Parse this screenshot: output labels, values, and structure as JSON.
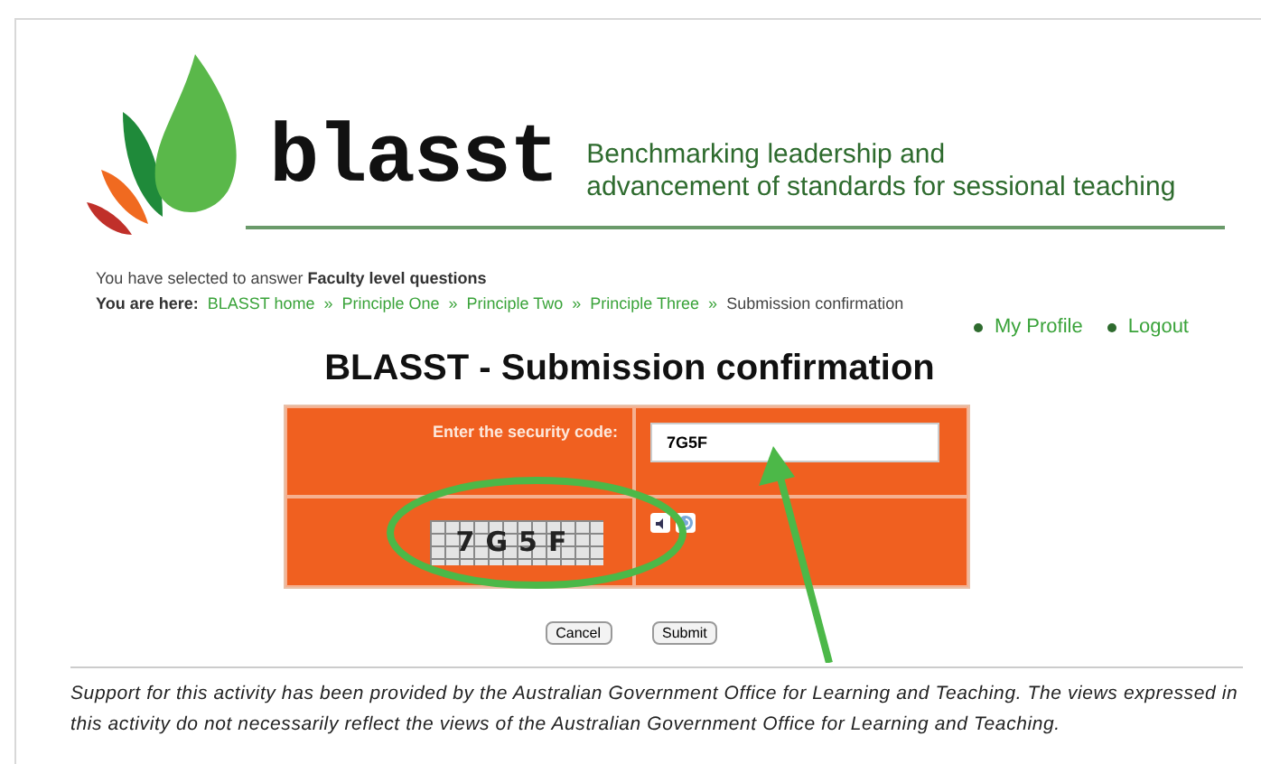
{
  "header": {
    "logo_text": "blasst",
    "tagline_lines": [
      "Benchmarking leadership and",
      "advancement of standards for sessional teaching"
    ]
  },
  "selection_note": {
    "prefix": "You have selected to answer ",
    "emphasis": "Faculty level questions"
  },
  "breadcrumb": {
    "label": "You are here:",
    "links": [
      "BLASST home",
      "Principle One",
      "Principle Two",
      "Principle Three"
    ],
    "separator": "»",
    "current": "Submission confirmation"
  },
  "user_links": [
    "My Profile",
    "Logout"
  ],
  "title": "BLASST - Submission confirmation",
  "security_form": {
    "label": "Enter the security code:",
    "value": "7G5F",
    "captcha_text": "7G5F"
  },
  "buttons": [
    "Cancel",
    "Submit"
  ],
  "footer": "Support for this activity has been provided by the Australian Government Office for Learning and Teaching. The views expressed in this activity do not necessarily reflect the views of the Australian Government Office for Learning and Teaching."
}
